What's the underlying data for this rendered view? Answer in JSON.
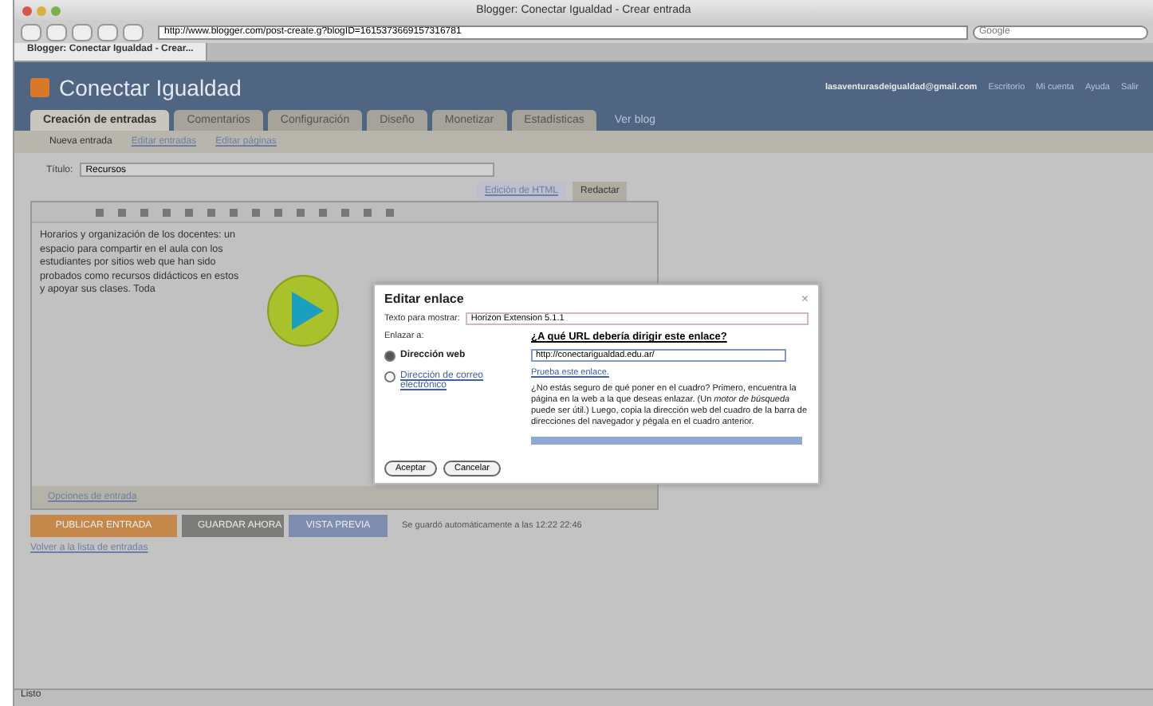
{
  "window": {
    "title": "Blogger: Conectar Igualdad - Crear entrada"
  },
  "toolbar": {
    "url": "http://www.blogger.com/post-create.g?blogID=1615373669157316781",
    "search": {
      "placeholder": "Google"
    }
  },
  "browser_tabs": [
    {
      "label": "Blogger: Conectar Igualdad - Crear...",
      "selected": true
    }
  ],
  "header": {
    "blog_name": "Conectar Igualdad",
    "account": "lasaventurasdeigualdad@gmail.com",
    "links": [
      "Escritorio",
      "Mi cuenta",
      "Ayuda",
      "Salir"
    ]
  },
  "tabs": [
    {
      "label": "Creación de entradas",
      "selected": true
    },
    {
      "label": "Comentarios",
      "selected": false
    },
    {
      "label": "Configuración",
      "selected": false
    },
    {
      "label": "Diseño",
      "selected": false
    },
    {
      "label": "Monetizar",
      "selected": false
    },
    {
      "label": "Estadísticas",
      "selected": false
    }
  ],
  "view_blog": "Ver blog",
  "subtabs": [
    {
      "label": "Nueva entrada",
      "selected": true
    },
    {
      "label": "Editar entradas",
      "selected": false
    },
    {
      "label": "Editar páginas",
      "selected": false
    }
  ],
  "title_field": {
    "label": "Título:",
    "value": "Recursos"
  },
  "editor_modes": [
    {
      "label": "Edición de HTML",
      "selected": false
    },
    {
      "label": "Redactar",
      "selected": true
    }
  ],
  "editor_text": "Horarios y organización de los docentes: un espacio para compartir en el aula con los estudiantes por sitios web que han sido probados como recursos didácticos en estos y apoyar sus clases. Toda",
  "post_options": "Opciones de entrada",
  "actions": [
    "PUBLICAR ENTRADA",
    "GUARDAR AHORA",
    "VISTA PREVIA"
  ],
  "autosave": "Se guardó automáticamente a las 12:22 22:46",
  "back_link": "Volver a la lista de entradas",
  "dialog": {
    "title": "Editar enlace",
    "close": "×",
    "text_label": "Texto para mostrar:",
    "text_value": "Horizon Extension 5.1.1",
    "link_to": "Enlazar a:",
    "options": [
      {
        "label": "Dirección web",
        "selected": true
      },
      {
        "label": "Dirección de correo electrónico",
        "selected": false
      }
    ],
    "url_question": "¿A qué URL debería dirigir este enlace?",
    "url_value": "http://conectarigualdad.edu.ar/",
    "test_link": "Prueba este enlace.",
    "help": "¿No estás seguro de qué poner en el cuadro? Primero, encuentra la página en la web a la que deseas enlazar. (Un *motor de búsqueda* puede ser útil.) Luego, copia la dirección web del cuadro de la barra de direcciones del navegador y pégala en el cuadro anterior.",
    "buttons": [
      "Aceptar",
      "Cancelar"
    ]
  },
  "status_bar": "Listo"
}
